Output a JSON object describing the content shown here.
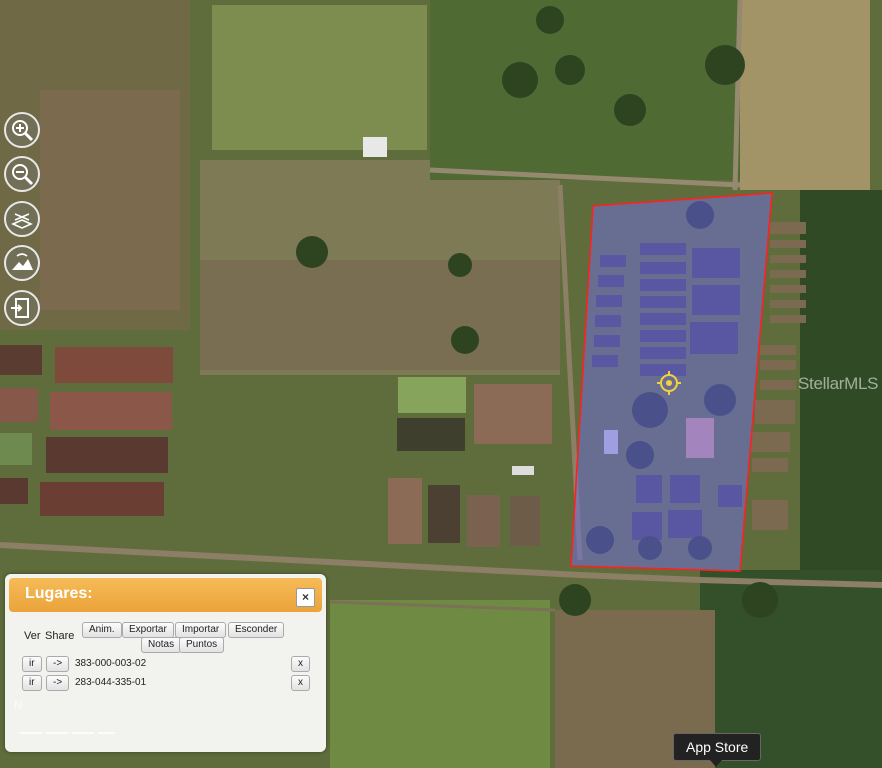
{
  "map": {
    "watermark": "StellarMLS",
    "app_store_label": "App Store",
    "north_label": "N",
    "parcel_outline_color": "#ff2020",
    "parcel_fill_color": "#6f6fd8"
  },
  "controls": [
    {
      "name": "zoom-in-icon"
    },
    {
      "name": "zoom-out-icon"
    },
    {
      "name": "street-view-icon"
    },
    {
      "name": "terrain-icon"
    },
    {
      "name": "exit-icon"
    }
  ],
  "panel": {
    "title": "Lugares:",
    "close_label": "×",
    "col_ver": "Ver",
    "col_share": "Share",
    "toolbar": {
      "anim": "Anim.",
      "exportar": "Exportar",
      "importar": "Importar",
      "esconder": "Esconder",
      "notas": "Notas",
      "puntos": "Puntos"
    },
    "rows": [
      {
        "go": "ir",
        "share": "->",
        "id": "383-000-003-02",
        "remove": "x"
      },
      {
        "go": "ir",
        "share": "->",
        "id": "283-044-335-01",
        "remove": "x"
      }
    ]
  }
}
